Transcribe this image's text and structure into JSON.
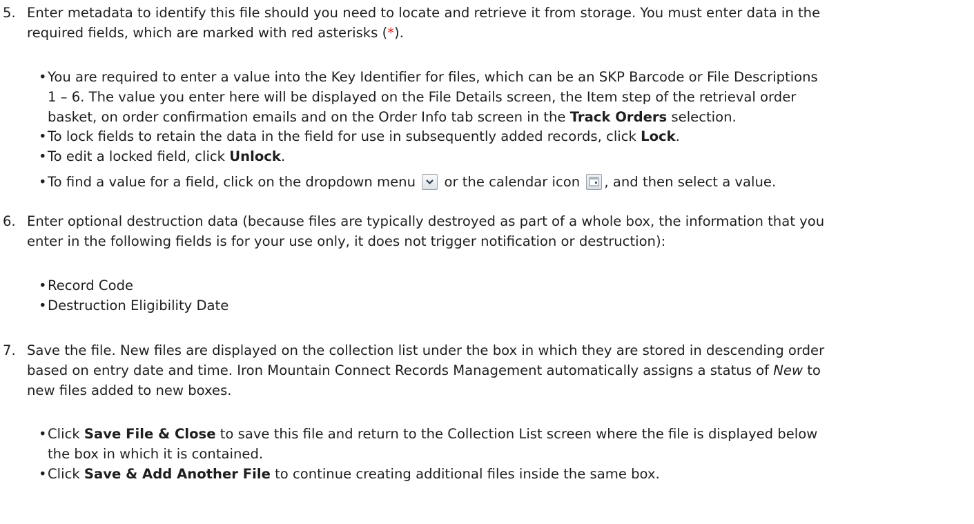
{
  "steps": [
    {
      "number": "5.",
      "text_a": "Enter metadata to identify this file should you need to locate and retrieve it from storage. You must enter data in the",
      "text_b_pre": "required fields, which are marked with red asterisks (",
      "star": "*",
      "text_b_post": ").",
      "bullets": [
        {
          "line1": "You are required to enter a value into the Key Identifier for files, which can be an SKP Barcode or File Descriptions",
          "line2": "1 – 6. The value you enter here will be displayed on the File Details screen, the Item step of the retrieval order",
          "line3_pre": "basket, on order confirmation emails and on the Order Info tab screen in the ",
          "line3_bold": "Track Orders",
          "line3_post": " selection."
        },
        {
          "pre": "To lock fields to retain the data in the field for use in subsequently added records, click ",
          "bold": "Lock",
          "post": "."
        },
        {
          "pre": "To edit a locked field, click ",
          "bold": "Unlock",
          "post": "."
        },
        {
          "pre": "To find a value for a field, click on the dropdown menu",
          "mid": "or the calendar icon",
          "post": ", and then select a value.",
          "icon1": "dropdown-icon",
          "icon2": "calendar-icon"
        }
      ]
    },
    {
      "number": "6.",
      "text_a": "Enter optional destruction data (because files are typically destroyed as part of a whole box, the information that you",
      "text_b": "enter in the following fields is for your use only, it does not trigger notification or destruction):",
      "bullets": [
        "Record Code",
        "Destruction Eligibility Date"
      ]
    },
    {
      "number": "7.",
      "text_a": "Save the file.  New files are displayed on the collection list under the box in which they are stored in descending order",
      "text_b_pre": "based on entry date and time. Iron Mountain Connect Records Management automatically assigns a status of ",
      "text_b_italic": "New",
      "text_b_post": " to",
      "text_c": "new files added to new boxes.",
      "bullets": [
        {
          "pre": "Click ",
          "bold": "Save File & Close",
          "post": " to save this file and return to the Collection List screen where the file is displayed below",
          "line2": "the box in which it is contained."
        },
        {
          "pre": "Click ",
          "bold": "Save & Add Another File",
          "post": " to continue creating additional files inside the same box."
        }
      ]
    }
  ]
}
